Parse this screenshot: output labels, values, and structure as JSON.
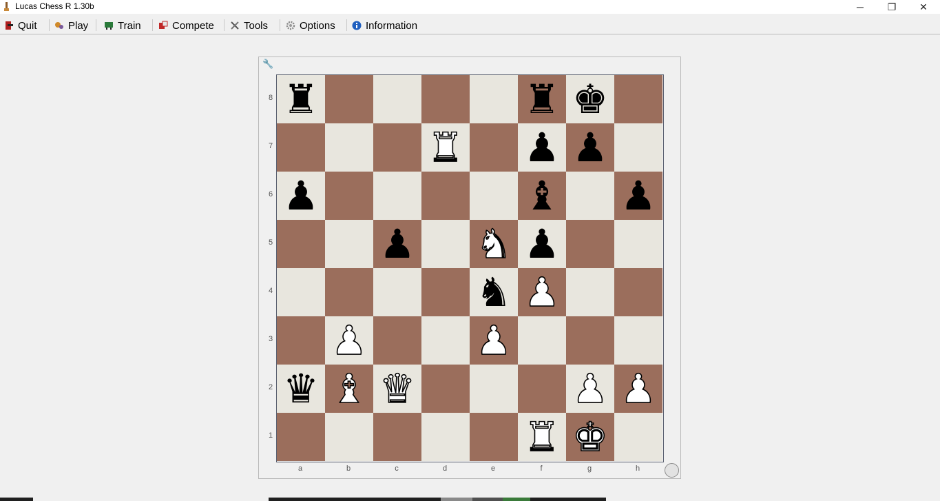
{
  "window": {
    "title": "Lucas Chess R 1.30b",
    "minimize_glyph": "─",
    "maximize_glyph": "❐",
    "close_glyph": "✕"
  },
  "menu": {
    "items": [
      {
        "label": "Quit",
        "icon": "quit-icon"
      },
      {
        "label": "Play",
        "icon": "play-icon"
      },
      {
        "label": "Train",
        "icon": "train-icon"
      },
      {
        "label": "Compete",
        "icon": "compete-icon"
      },
      {
        "label": "Tools",
        "icon": "tools-icon"
      },
      {
        "label": "Options",
        "icon": "options-icon"
      },
      {
        "label": "Information",
        "icon": "information-icon"
      }
    ]
  },
  "board": {
    "rank_labels": [
      "8",
      "7",
      "6",
      "5",
      "4",
      "3",
      "2",
      "1"
    ],
    "file_labels": [
      "a",
      "b",
      "c",
      "d",
      "e",
      "f",
      "g",
      "h"
    ],
    "position": [
      [
        "br",
        "",
        "",
        "",
        "",
        "br",
        "bk",
        ""
      ],
      [
        "",
        "",
        "",
        "wr",
        "",
        "bp",
        "bp",
        ""
      ],
      [
        "bp",
        "",
        "",
        "",
        "",
        "bb",
        "",
        "bp"
      ],
      [
        "",
        "",
        "bp",
        "",
        "wn",
        "bp",
        "",
        ""
      ],
      [
        "",
        "",
        "",
        "",
        "bn",
        "wp",
        "",
        ""
      ],
      [
        "",
        "wp",
        "",
        "",
        "wp",
        "",
        "",
        ""
      ],
      [
        "bq",
        "wb",
        "wq",
        "",
        "",
        "",
        "wp",
        "wp"
      ],
      [
        "",
        "",
        "",
        "",
        "",
        "wr",
        "wk",
        ""
      ]
    ],
    "light_color": "#e8e6de",
    "dark_color": "#9b6e5c",
    "side_to_move": "white"
  }
}
